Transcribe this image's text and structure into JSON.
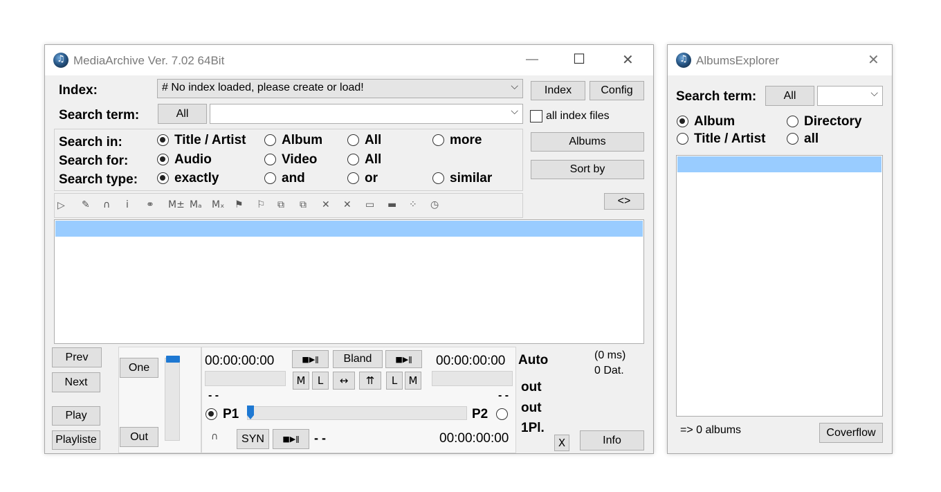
{
  "main_window": {
    "title": "MediaArchive Ver. 7.02 64Bit",
    "minimize": "—",
    "maximize": "☐",
    "close": "✕",
    "index_label": "Index:",
    "index_value": "# No index loaded, please create or load!",
    "search_term_label": "Search term:",
    "search_all_button": "All",
    "search_value": "",
    "index_button": "Index",
    "config_button": "Config",
    "all_index_files": "all index files",
    "albums_button": "Albums",
    "sort_by_button": "Sort by",
    "toggle_button": "<>",
    "search_in": {
      "label": "Search in:",
      "options": [
        "Title / Artist",
        "Album",
        "All",
        "more"
      ],
      "selected": 0
    },
    "search_for": {
      "label": "Search for:",
      "options": [
        "Audio",
        "Video",
        "All"
      ],
      "selected": 0
    },
    "search_type": {
      "label": "Search type:",
      "options": [
        "exactly",
        "and",
        "or",
        "similar"
      ],
      "selected": 0
    },
    "toolbar_icons": [
      "play-icon",
      "edit-icon",
      "headphones-icon",
      "info-icon",
      "group-icon",
      "m-plus-icon",
      "m-a-icon",
      "m-x-icon",
      "flag-icon",
      "flag2-icon",
      "copy-icon",
      "copy2-icon",
      "delete-icon",
      "delete2-icon",
      "folder-icon",
      "drive-icon",
      "link-icon",
      "timer-icon"
    ],
    "player": {
      "prev": "Prev",
      "next": "Next",
      "play": "Play",
      "playlist": "Playliste",
      "one": "One",
      "out": "Out",
      "time_left": "00:00:00:00",
      "time_right": "00:00:00:00",
      "time_bottom": "00:00:00:00",
      "bland": "Bland",
      "m": "M",
      "l": "L",
      "dash_left": "- -",
      "dash_right": "- -",
      "dash_bottom": "- -",
      "p1": "P1",
      "p2": "P2",
      "syn": "SYN",
      "auto": "Auto",
      "out1": "out",
      "out2": "out",
      "one_pl": "1Pl.",
      "ms": "(0 ms)",
      "dat": "0 Dat.",
      "x": "X",
      "info": "Info"
    }
  },
  "albums_window": {
    "title": "AlbumsExplorer",
    "close": "✕",
    "search_term_label": "Search term:",
    "all_button": "All",
    "combo_value": "",
    "options": [
      "Album",
      "Directory",
      "Title / Artist",
      "all"
    ],
    "selected": 0,
    "status": "=> 0 albums",
    "coverflow": "Coverflow"
  }
}
